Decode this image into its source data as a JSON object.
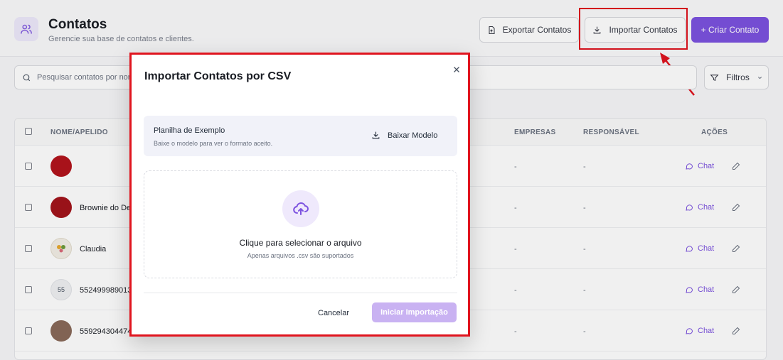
{
  "header": {
    "title": "Contatos",
    "subtitle": "Gerencie sua base de contatos e clientes.",
    "icon": "users-icon",
    "export_label": "Exportar Contatos",
    "import_label": "Importar Contatos",
    "create_label": "+ Criar Contato"
  },
  "search": {
    "placeholder": "Pesquisar contatos por nor"
  },
  "filters": {
    "label": "Filtros"
  },
  "table": {
    "columns": [
      "NOME/APELIDO",
      "EMPRESAS",
      "RESPONSÁVEL",
      "AÇÕES"
    ],
    "rows": [
      {
        "name": "",
        "avatar": "logo",
        "empresas": "-",
        "responsavel": "-",
        "chat": "Chat"
      },
      {
        "name": "Brownie do De",
        "avatar": "logo",
        "empresas": "-",
        "responsavel": "-",
        "chat": "Chat"
      },
      {
        "name": "Claudia",
        "avatar": "floral",
        "empresas": "-",
        "responsavel": "-",
        "chat": "Chat"
      },
      {
        "name": "552499989013",
        "avatar": "55",
        "empresas": "-",
        "responsavel": "-",
        "chat": "Chat"
      },
      {
        "name": "559294304474",
        "avatar": "photo",
        "empresas": "-",
        "responsavel": "-",
        "chat": "Chat"
      }
    ]
  },
  "modal": {
    "title": "Importar Contatos por CSV",
    "sample_title": "Planilha de Exemplo",
    "sample_sub": "Baixe o modelo para ver o formato aceito.",
    "download_label": "Baixar Modelo",
    "drop_title": "Clique para selecionar o arquivo",
    "drop_sub": "Apenas arquivos .csv são suportados",
    "cancel_label": "Cancelar",
    "start_label": "Iniciar Importação"
  },
  "colors": {
    "accent": "#7c52e0",
    "highlight": "#e0141e",
    "disabled_button": "#c9b2f2"
  }
}
